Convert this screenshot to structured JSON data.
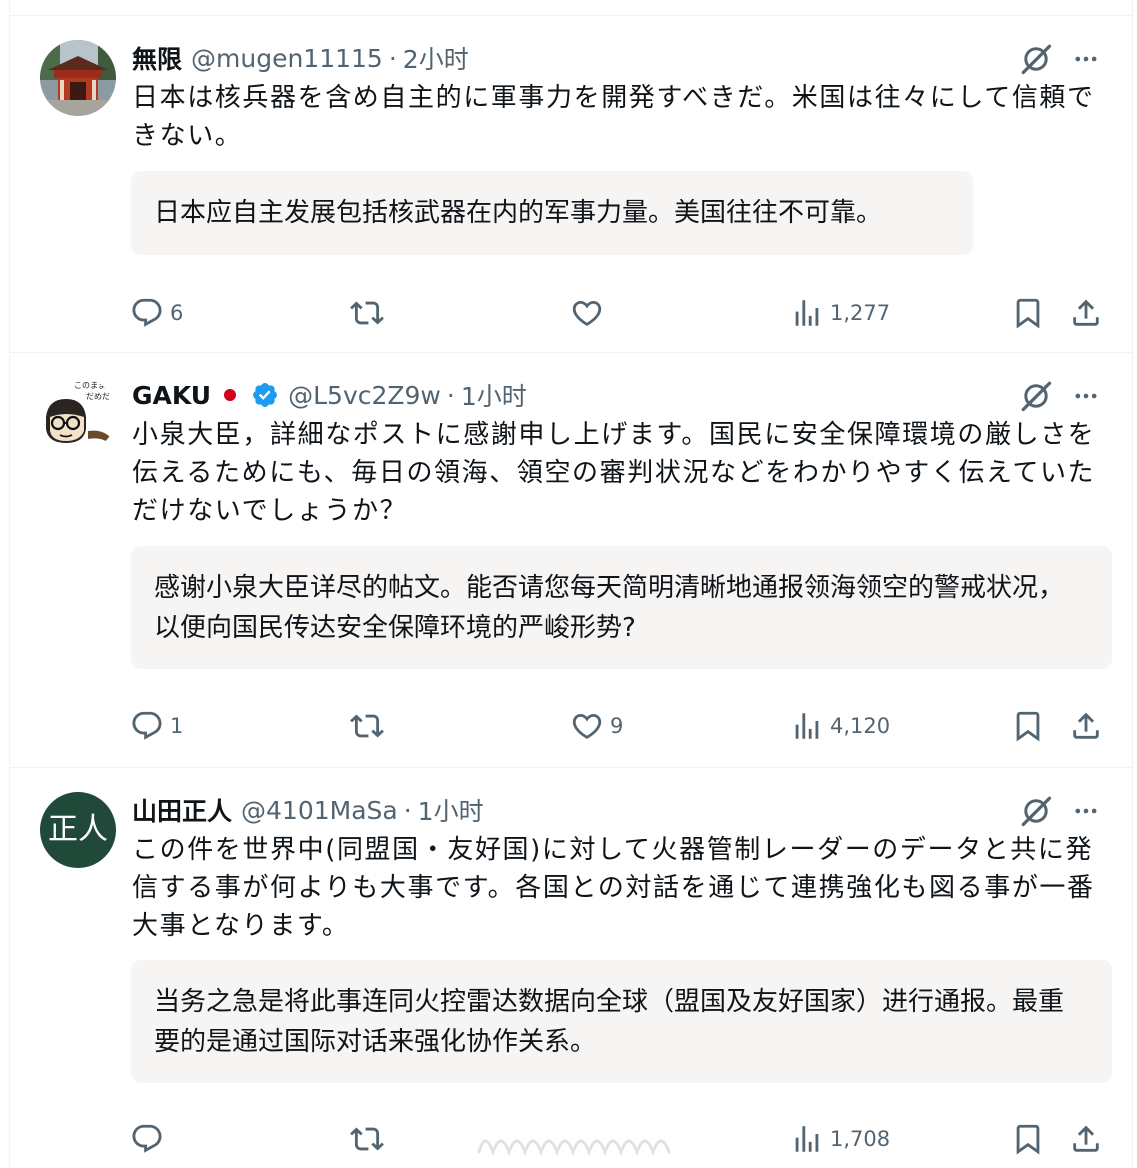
{
  "posts": [
    {
      "name": "無限",
      "handle": "@mugen11115",
      "separator": "·",
      "time": "2小时",
      "avatar_icon": "shrine-photo-avatar",
      "text": "日本は核兵器を含め自主的に軍事力を開発すべきだ。米国は往々にして信頼できない。",
      "translation": "日本应自主发展包括核武器在内的军事力量。美国往往不可靠。",
      "replies": "6",
      "reposts": "",
      "likes": "",
      "views": "1,277"
    },
    {
      "name": "GAKU",
      "flag_icon": "japan-flag-icon",
      "verified_icon": "verified-badge-icon",
      "handle": "@L5vc2Z9w",
      "separator": "·",
      "time": "1小时",
      "avatar_icon": "cartoon-glasses-avatar",
      "avatar_caption_1": "このままじゃ",
      "avatar_caption_2": "だめだ",
      "text": "小泉大臣，詳細なポストに感謝申し上げます。国民に安全保障環境の厳しさを伝えるためにも、毎日の領海、領空の審判状況などをわかりやすく伝えていただけないでしょうか？",
      "translation": "感谢小泉大臣详尽的帖文。能否请您每天简明清晰地通报领海领空的警戒状况，以便向国民传达安全保障环境的严峻形势?",
      "replies": "1",
      "reposts": "",
      "likes": "9",
      "views": "4,120"
    },
    {
      "name": "山田正人",
      "handle": "@4101MaSa",
      "separator": "·",
      "time": "1小时",
      "avatar_text": "正人",
      "avatar_color": "#20493a",
      "text": "この件を世界中(同盟国・友好国)に対して火器管制レーダーのデータと共に発信する事が何よりも大事です。各国との対話を通じて連携強化も図る事が一番大事となります。",
      "translation": "当务之急是将此事连同火控雷达数据向全球（盟国及友好国家）进行通报。最重要的是通过国际对话来强化协作关系。",
      "replies": "",
      "reposts": "",
      "likes": "",
      "views": "1,708"
    }
  ],
  "icons": {
    "reply": "reply-icon",
    "repost": "repost-icon",
    "like": "heart-icon",
    "views": "views-chart-icon",
    "bookmark": "bookmark-icon",
    "share": "share-icon",
    "grok": "grok-icon",
    "more": "more-icon"
  },
  "colors": {
    "text_primary": "#0f1419",
    "text_secondary": "#536471",
    "verified_blue": "#1d9bf0",
    "translation_bg": "#f7f4f4",
    "divider": "#eff3f4"
  }
}
